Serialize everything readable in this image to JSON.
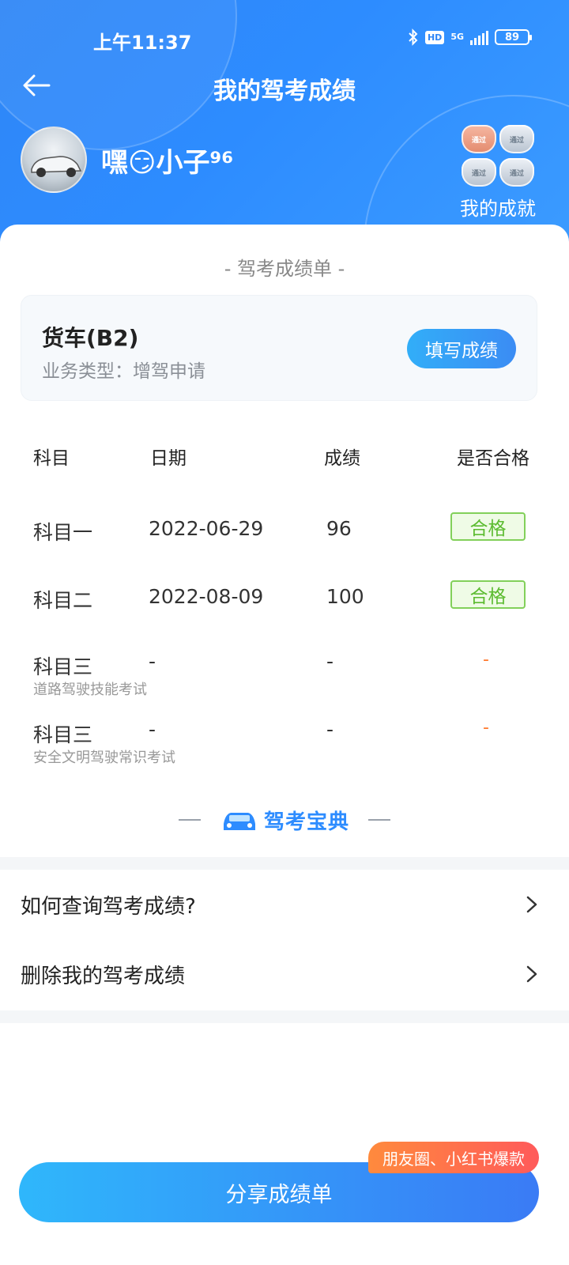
{
  "status_bar": {
    "time": "上午11:37",
    "hd": "HD",
    "network": "5G",
    "battery": "89"
  },
  "nav": {
    "title": "我的驾考成绩"
  },
  "profile": {
    "username": "嘿😏小子⁹⁶",
    "achievements_label": "我的成就",
    "medals": [
      "通过",
      "通过",
      "通过",
      "通过"
    ]
  },
  "report": {
    "title": "- 驾考成绩单 -",
    "license_type": "货车(B2)",
    "business_type": "业务类型：增驾申请",
    "fill_button": "填写成绩"
  },
  "table": {
    "headers": [
      "科目",
      "日期",
      "成绩",
      "是否合格"
    ],
    "rows": [
      {
        "subject": "科目一",
        "subtitle": "",
        "date": "2022-06-29",
        "score": "96",
        "result": "合格"
      },
      {
        "subject": "科目二",
        "subtitle": "",
        "date": "2022-08-09",
        "score": "100",
        "result": "合格"
      },
      {
        "subject": "科目三",
        "subtitle": "道路驾驶技能考试",
        "date": "-",
        "score": "-",
        "result": "-"
      },
      {
        "subject": "科目三",
        "subtitle": "安全文明驾驶常识考试",
        "date": "-",
        "score": "-",
        "result": "-"
      }
    ]
  },
  "brand": {
    "name": "驾考宝典"
  },
  "menu": {
    "items": [
      {
        "label": "如何查询驾考成绩?"
      },
      {
        "label": "删除我的驾考成绩"
      }
    ]
  },
  "footer": {
    "share_button": "分享成绩单",
    "promo_tag": "朋友圈、小红书爆款"
  },
  "colors": {
    "primary": "#2d8cff",
    "pass_green": "#5bbb2f",
    "dash_orange": "#ff7a2f"
  }
}
